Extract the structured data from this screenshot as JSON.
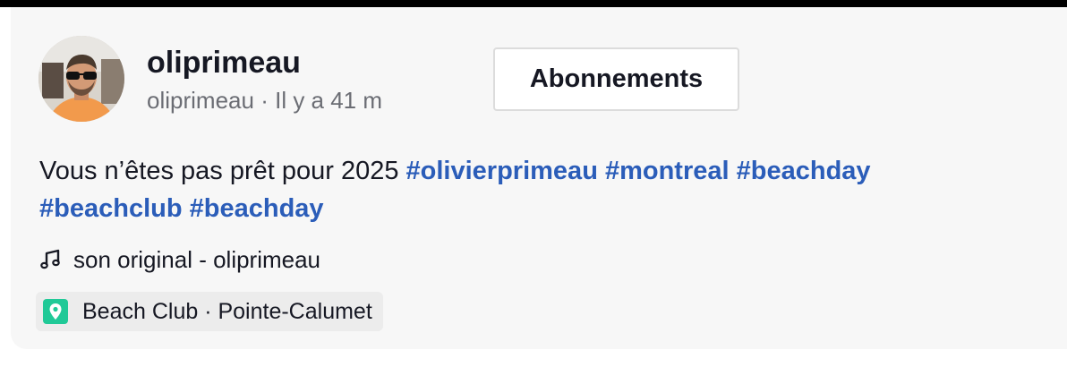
{
  "post": {
    "username": "oliprimeau",
    "handle": "oliprimeau",
    "separator": "·",
    "time_ago": "Il y a 41 m",
    "follow_label": "Abonnements",
    "caption_text": "Vous n’êtes pas prêt pour 2025",
    "hashtags": [
      "#olivierprimeau",
      "#montreal",
      "#beachday",
      "#beachclub",
      "#beachday"
    ],
    "sound": {
      "icon": "music-note-icon",
      "label": "son original - oliprimeau"
    },
    "location": {
      "icon": "location-pin-icon",
      "label": "Beach Club · Pointe-Calumet",
      "icon_color": "#20c997"
    },
    "avatar": {
      "icon": "user-avatar"
    }
  },
  "colors": {
    "hashtag": "#2b5db9",
    "card_background": "#f7f7f7",
    "top_bar": "#000000"
  }
}
